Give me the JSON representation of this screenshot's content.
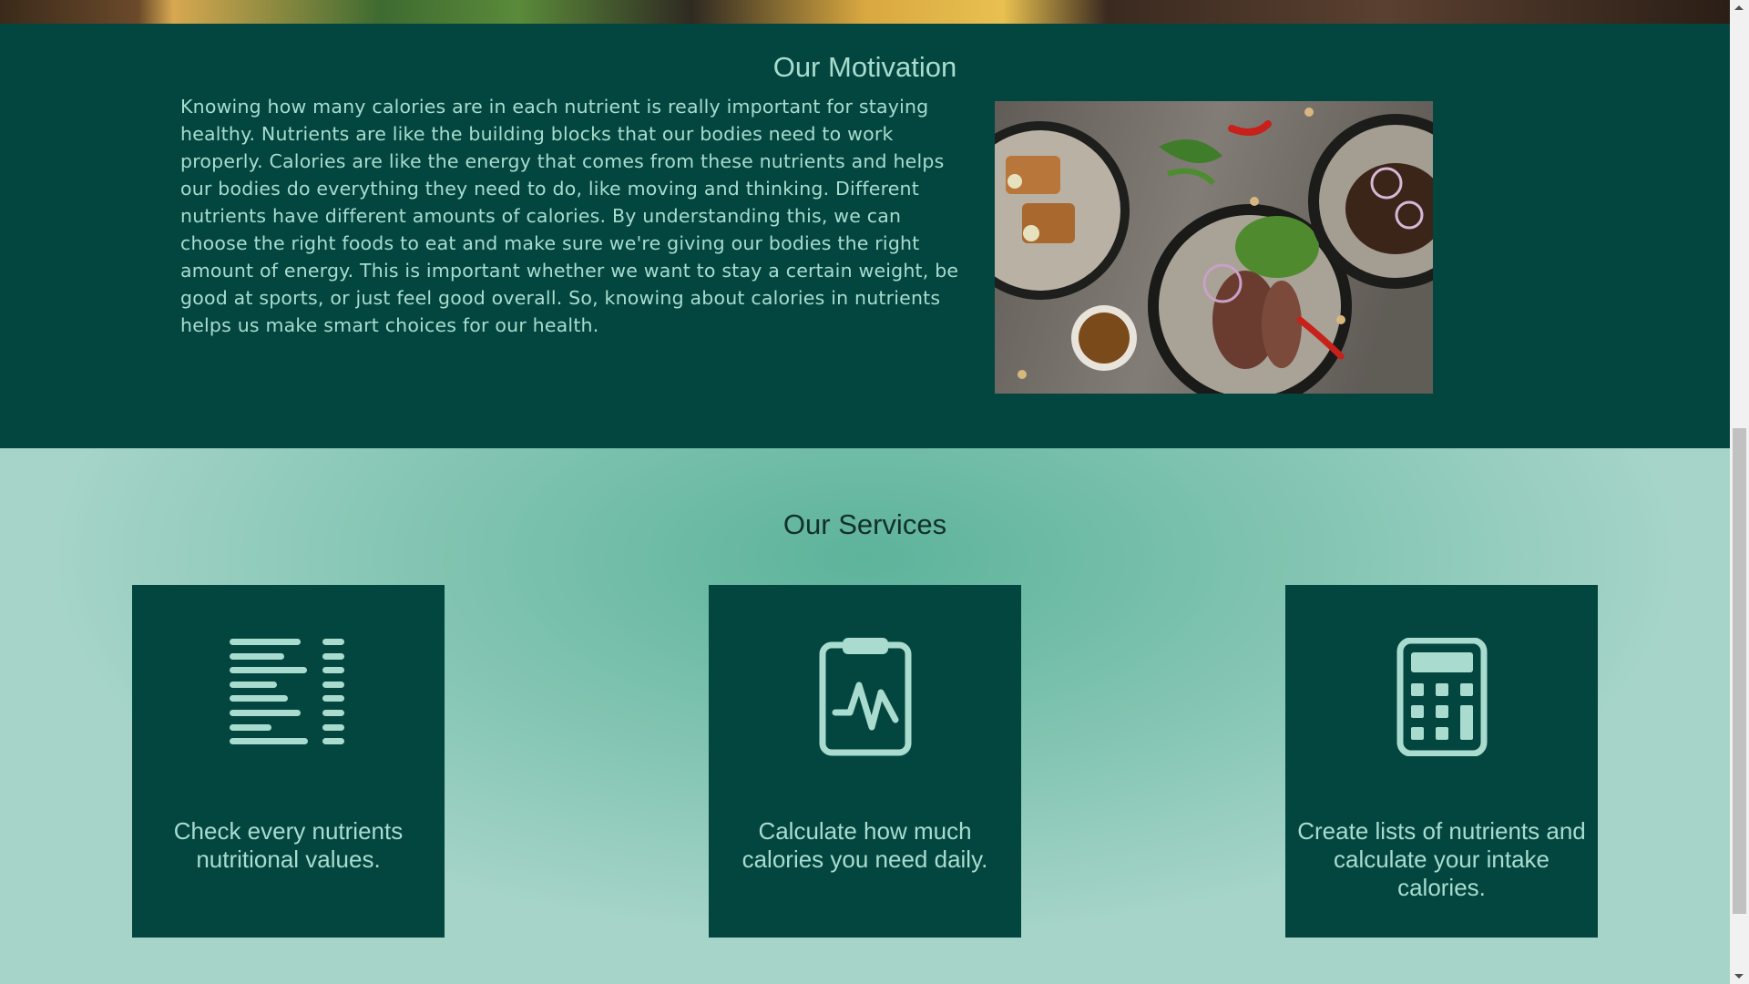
{
  "motivation": {
    "title": "Our Motivation",
    "paragraph": "Knowing how many calories are in each nutrient is really important for staying healthy. Nutrients are like the building blocks that our bodies need to work properly. Calories are like the energy that comes from these nutrients and helps our bodies do everything they need to do, like moving and thinking. Different nutrients have different amounts of calories. By understanding this, we can choose the right foods to eat and make sure we're giving our bodies the right amount of energy. This is important whether we want to stay a certain weight, be good at sports, or just feel good overall. So, knowing about calories in nutrients helps us make smart choices for our health."
  },
  "services": {
    "title": "Our Services",
    "cards": [
      {
        "icon": "nutrition-list-icon",
        "text": "Check every nutrients nutritional values."
      },
      {
        "icon": "clipboard-pulse-icon",
        "text": "Calculate how much calories you need daily."
      },
      {
        "icon": "calculator-icon",
        "text": "Create lists of nutrients and calculate your intake calories."
      }
    ]
  },
  "colors": {
    "dark_green": "#02463f",
    "light_text": "#a9dccf",
    "services_bg": "#83c5b2",
    "icon_color": "#a9dccf"
  }
}
